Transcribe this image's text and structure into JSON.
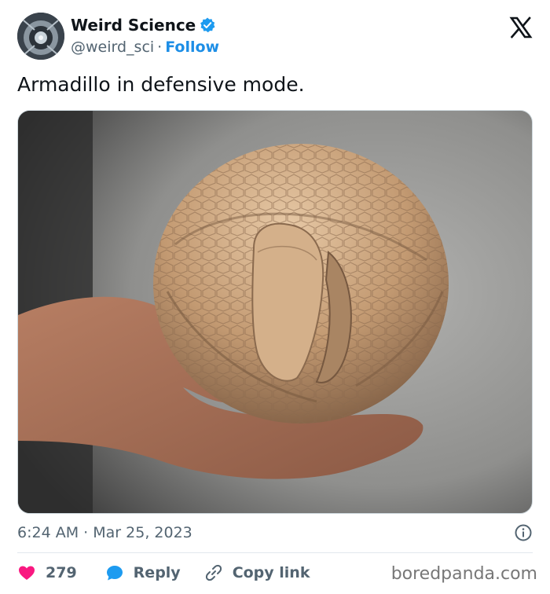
{
  "author": {
    "name": "Weird Science",
    "handle": "@weird_sci",
    "separator": "·",
    "follow_label": "Follow",
    "verified": true,
    "badge_color": "#1d9bf0"
  },
  "brand_icon": "x-logo-icon",
  "tweet": {
    "text": "Armadillo in defensive mode.",
    "image_subject": "armadillo-photo"
  },
  "meta": {
    "time": "6:24 AM",
    "separator": "·",
    "date": "Mar 25, 2023"
  },
  "actions": {
    "like_count": "279",
    "like_color": "#f91880",
    "reply_label": "Reply",
    "reply_color": "#1d9bf0",
    "copy_label": "Copy link"
  },
  "watermark": "boredpanda.com"
}
